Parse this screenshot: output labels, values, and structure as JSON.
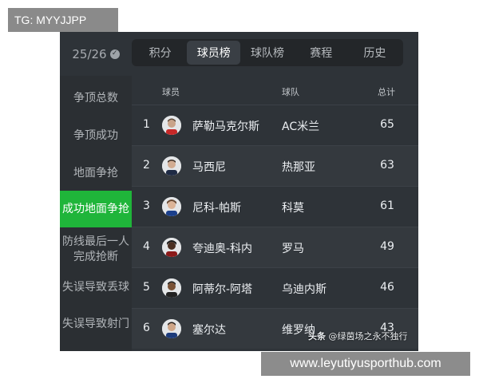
{
  "overlay_top_label": "TG: MYYJJPP",
  "overlay_bottom_label": "www.leyutiyusporthub.com",
  "season": {
    "label": "25/26",
    "check_icon": "check-circle-icon"
  },
  "tabs": [
    {
      "label": "积分",
      "active": false
    },
    {
      "label": "球员榜",
      "active": true
    },
    {
      "label": "球队榜",
      "active": false
    },
    {
      "label": "赛程",
      "active": false
    },
    {
      "label": "历史",
      "active": false
    }
  ],
  "sidebar": {
    "items": [
      {
        "label": "争顶总数",
        "active": false
      },
      {
        "label": "争顶成功",
        "active": false
      },
      {
        "label": "地面争抢",
        "active": false
      },
      {
        "label": "成功地面争抢",
        "active": true
      },
      {
        "label": "防线最后一人完成抢断",
        "active": false
      },
      {
        "label": "失误导致丢球",
        "active": false
      },
      {
        "label": "失误导致射门",
        "active": false
      }
    ]
  },
  "table": {
    "headers": {
      "player": "球员",
      "team": "球队",
      "total": "总计"
    },
    "rows": [
      {
        "rank": "1",
        "name": "萨勒马克尔斯",
        "team": "AC米兰",
        "total": "65"
      },
      {
        "rank": "2",
        "name": "马西尼",
        "team": "热那亚",
        "total": "63"
      },
      {
        "rank": "3",
        "name": "尼科-帕斯",
        "team": "科莫",
        "total": "61"
      },
      {
        "rank": "4",
        "name": "夸迪奥-科内",
        "team": "罗马",
        "total": "49"
      },
      {
        "rank": "5",
        "name": "阿蒂尔-阿塔",
        "team": "乌迪内斯",
        "total": "46"
      },
      {
        "rank": "6",
        "name": "塞尔达",
        "team": "维罗纳",
        "total": "43"
      }
    ]
  },
  "source_watermark": {
    "prefix": "头条",
    "text": "@绿茵场之永不独行"
  },
  "colors": {
    "panel_bg": "#2e3338",
    "sidebar_bg": "#2b2f33",
    "active_green": "#1fb53a",
    "tab_bar_bg": "#232629"
  }
}
